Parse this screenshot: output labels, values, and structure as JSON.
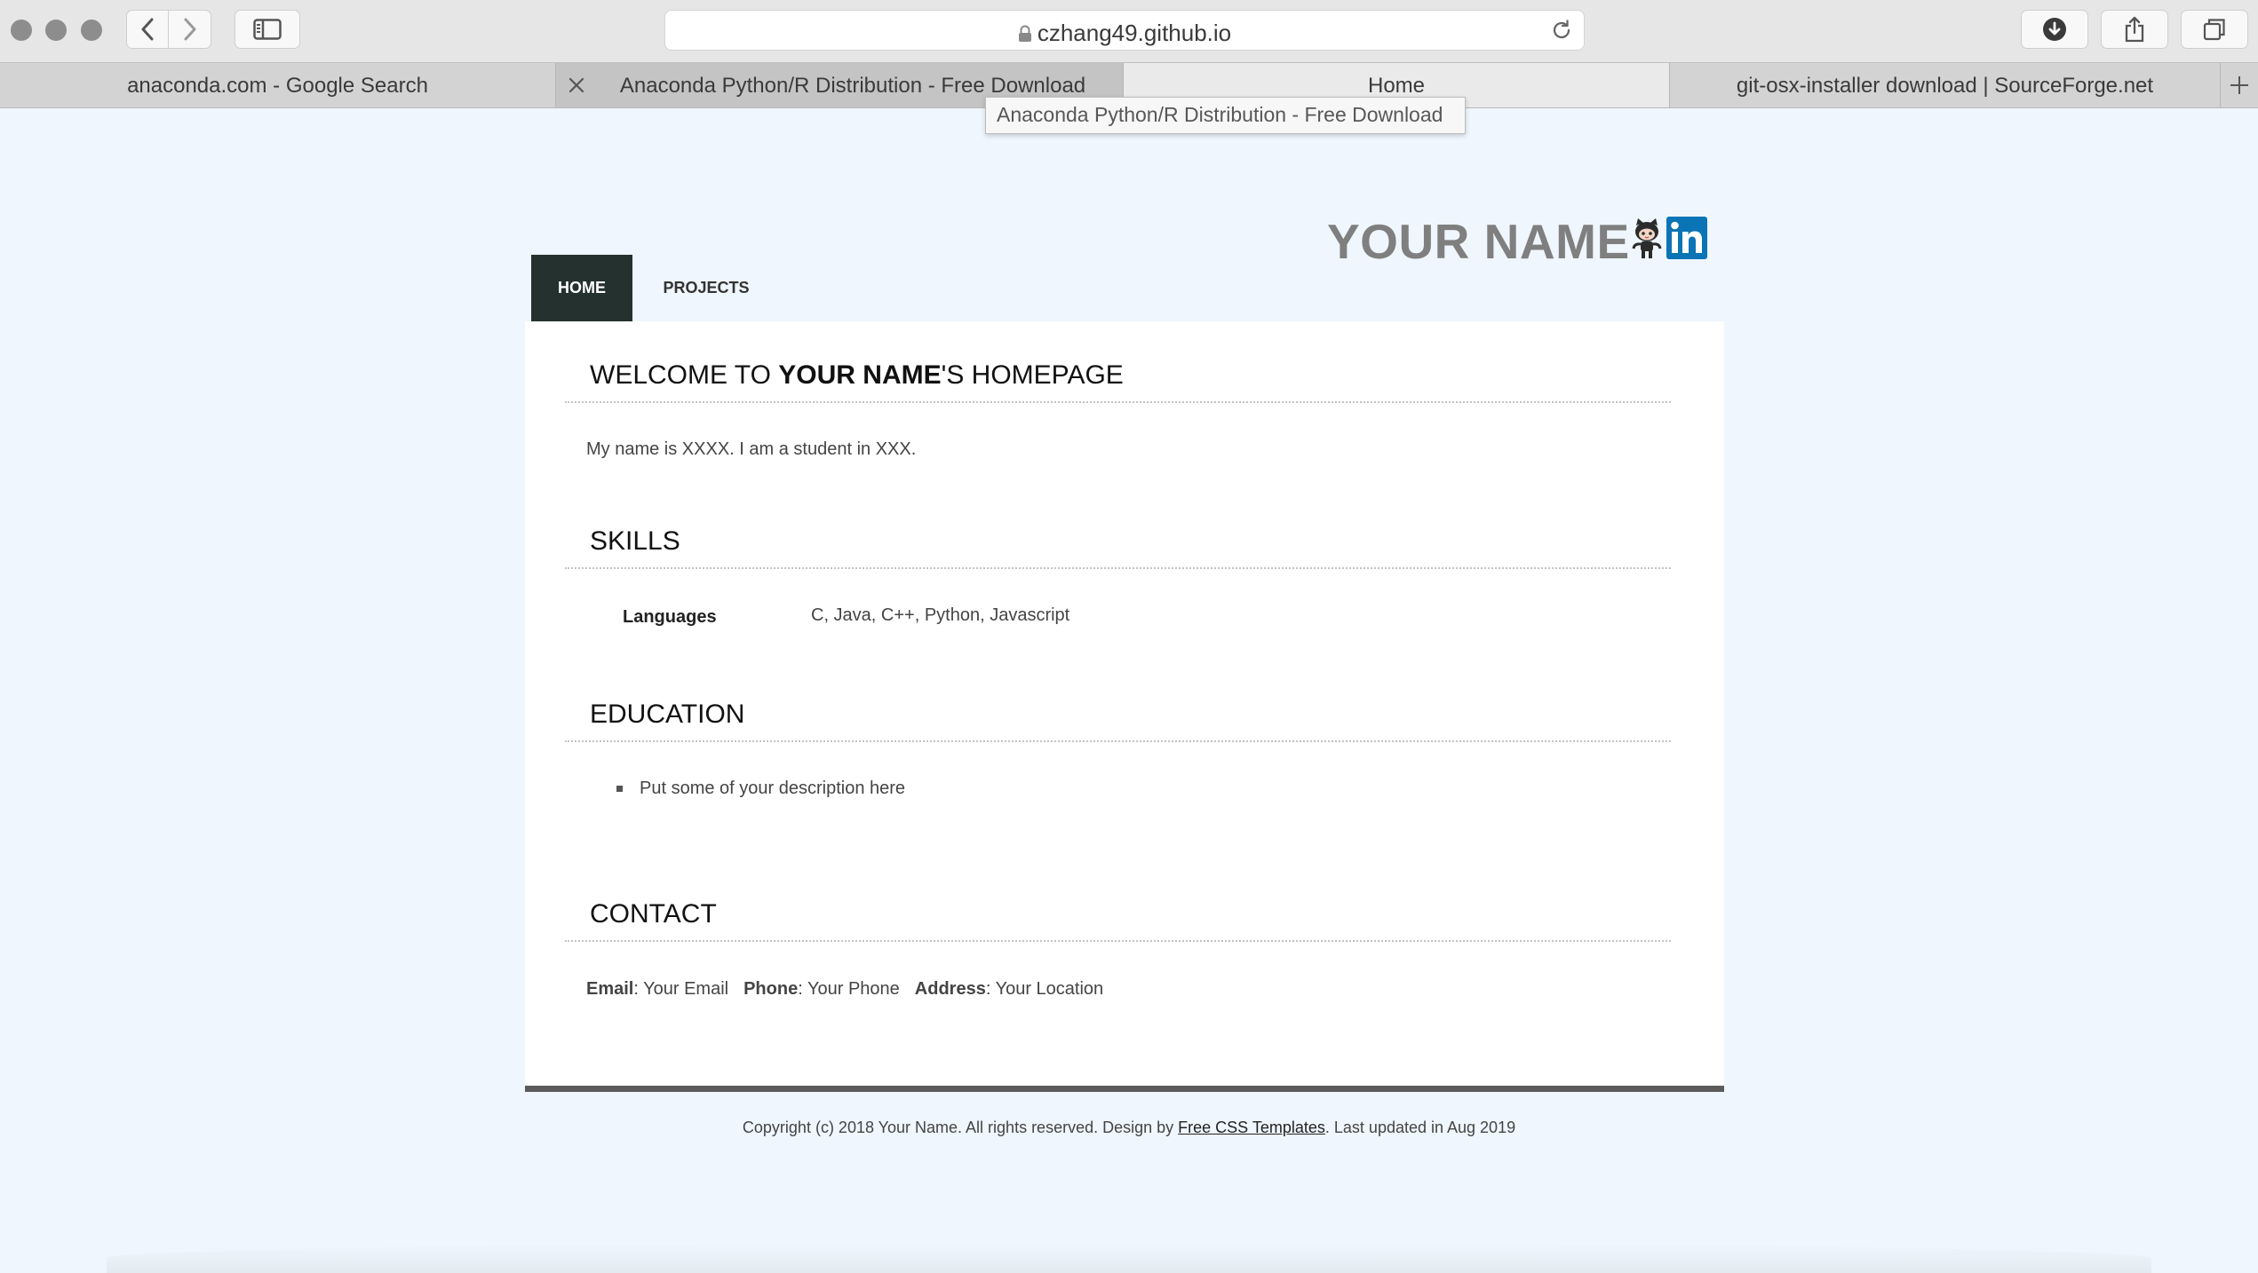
{
  "browser": {
    "url": "czhang49.github.io",
    "tabs": [
      {
        "title": "anaconda.com - Google Search"
      },
      {
        "title": "Anaconda Python/R Distribution - Free Download"
      },
      {
        "title": "Home"
      },
      {
        "title": "git-osx-installer download | SourceForge.net"
      }
    ],
    "tooltip": "Anaconda Python/R Distribution - Free Download"
  },
  "site": {
    "name": "YOUR NAME",
    "nav": {
      "home": "HOME",
      "projects": "PROJECTS"
    }
  },
  "welcome": {
    "prefix": "WELCOME TO ",
    "name": "YOUR NAME",
    "suffix": "'S HOMEPAGE",
    "text": "My name is XXXX. I am a student in XXX."
  },
  "skills": {
    "title": "SKILLS",
    "rows": [
      {
        "label": "Languages",
        "value": "C, Java, C++, Python, Javascript"
      }
    ]
  },
  "education": {
    "title": "EDUCATION",
    "items": [
      "Put some of your description here"
    ]
  },
  "contact": {
    "title": "CONTACT",
    "email_label": "Email",
    "email_value": ": Your Email",
    "phone_label": "Phone",
    "phone_value": ": Your Phone",
    "address_label": "Address",
    "address_value": ": Your Location"
  },
  "footer": {
    "prefix": "Copyright (c) 2018 Your Name. All rights reserved. Design by ",
    "link": "Free CSS Templates",
    "suffix": ". Last updated in Aug 2019"
  },
  "colors": {
    "page_bg": "#eff6fd",
    "nav_active": "#24312e",
    "linkedin": "#0a74b5",
    "name_gray": "#7f7f7f"
  }
}
